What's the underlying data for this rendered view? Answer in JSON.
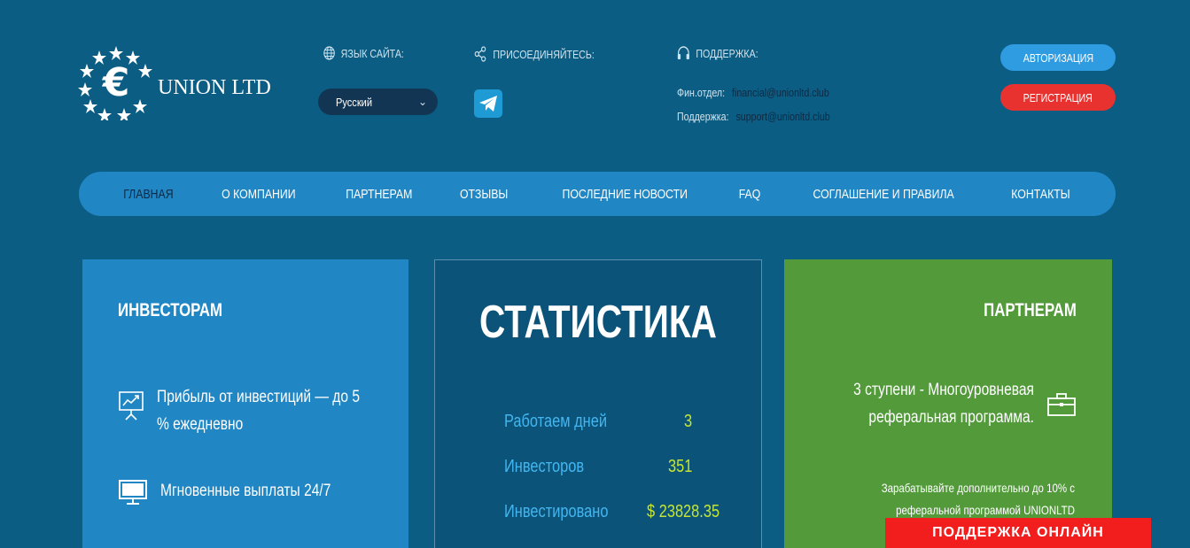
{
  "logo": {
    "name": "UNION LTD"
  },
  "header": {
    "language_label": "ЯЗЫК САЙТА:",
    "language_value": "Русский",
    "join_label": "ПРИСОЕДИНЯЙТЕСЬ:",
    "support_label": "ПОДДЕРЖКА:",
    "finance_label": "Фин.отдел:",
    "finance_email": "financial@unionltd.club",
    "support_row_label": "Поддержка:",
    "support_email": "support@unionltd.club",
    "auth_button": "АВТОРИЗАЦИЯ",
    "register_button": "РЕГИСТРАЦИЯ"
  },
  "nav": {
    "items": [
      "ГЛАВНАЯ",
      "О КОМПАНИИ",
      "ПАРТНЕРАМ",
      "ОТЗЫВЫ",
      "ПОСЛЕДНИЕ НОВОСТИ",
      "FAQ",
      "СОГЛАШЕНИЕ И ПРАВИЛА",
      "КОНТАКТЫ"
    ]
  },
  "investors": {
    "title": "ИНВЕСТОРАМ",
    "feature1": "Прибыль от инвестиций — до 5 % ежедневно",
    "feature2": "Мгновенные выплаты 24/7"
  },
  "stats": {
    "title": "СТАТИСТИКА",
    "rows": [
      {
        "label": "Работаем дней",
        "value": "3"
      },
      {
        "label": "Инвесторов",
        "value": "351"
      },
      {
        "label": "Инвестировано",
        "value": "$ 23828.35"
      }
    ]
  },
  "partners": {
    "title": "ПАРТНЕРАМ",
    "text": "3 ступени - Многоуровневая реферальная программа.",
    "subtext": "Зарабатывайте дополнительно до 10% с реферальной программой UNIONLTD"
  },
  "online_support": "ПОДДЕРЖКА ОНЛАЙН",
  "colors": {
    "background": "#0b5d83",
    "nav": "#2186c4",
    "stat_label": "#43b6f0",
    "stat_value": "#c4e633",
    "partners_card": "#529a3a",
    "register": "#e8322f",
    "online_support": "#f21e1e"
  },
  "icons": {
    "language": "globe-icon",
    "join": "share-icon",
    "support": "headphones-icon",
    "telegram": "telegram-icon",
    "investment": "chart-board-icon",
    "payouts": "monitor-icon",
    "partners": "briefcase-icon"
  }
}
